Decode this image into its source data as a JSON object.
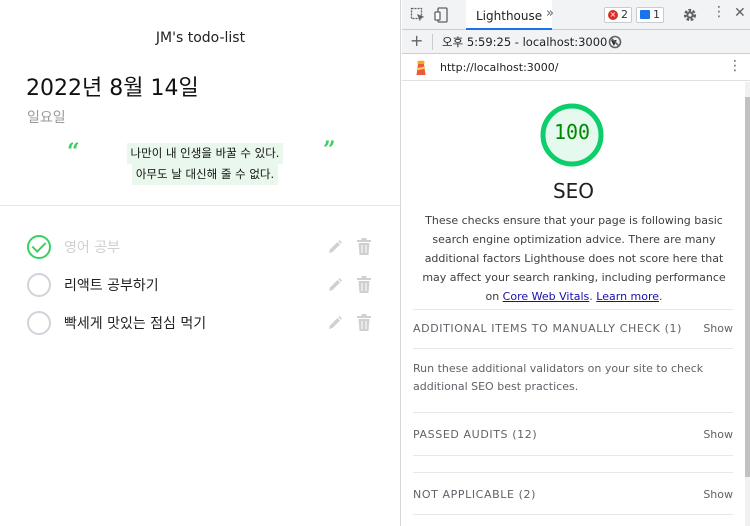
{
  "todo_app": {
    "title": "JM's todo-list",
    "date": "2022년 8월 14일",
    "weekday": "일요일",
    "quote_open": "“",
    "quote_close": "”",
    "quote_line1": "나만이 내 인생을 바꿀 수 있다.",
    "quote_line2": "아무도 날 대신해 줄 수 없다.",
    "todos": [
      {
        "text": "영어 공부",
        "done": true
      },
      {
        "text": "리액트 공부하기",
        "done": false
      },
      {
        "text": "빡세게 맛있는 점심 먹기",
        "done": false
      }
    ],
    "colors": {
      "accent": "#38d05e",
      "done_text": "#d0d0d0",
      "weekday": "#9a9a9a"
    }
  },
  "devtools": {
    "tab_label": "Lighthouse",
    "more_tabs": "»",
    "error_count": "2",
    "message_count": "1",
    "new_report": "+",
    "report_select": "오후 5:59:25 - localhost:3000 ▾",
    "url": "http://localhost:3000/",
    "kebab": "⋮",
    "close": "✕"
  },
  "lighthouse": {
    "score": "100",
    "score_value": 100,
    "category": "SEO",
    "description_pre": "These checks ensure that your page is following basic search engine optimization advice. There are many additional factors Lighthouse does not score here that may affect your search ranking, including performance on ",
    "link_cwv": "Core Web Vitals",
    "description_mid": ". ",
    "link_learn": "Learn more",
    "description_post": ".",
    "groups": [
      {
        "title": "ADDITIONAL ITEMS TO MANUALLY CHECK",
        "count": "(1)",
        "toggle": "Show",
        "description": "Run these additional validators on your site to check additional SEO best practices."
      },
      {
        "title": "PASSED AUDITS",
        "count": "(12)",
        "toggle": "Show"
      },
      {
        "title": "NOT APPLICABLE",
        "count": "(2)",
        "toggle": "Show"
      }
    ],
    "colors": {
      "pass": "#0cce6b",
      "pass_text": "#008800",
      "link": "#1a0dab"
    }
  }
}
